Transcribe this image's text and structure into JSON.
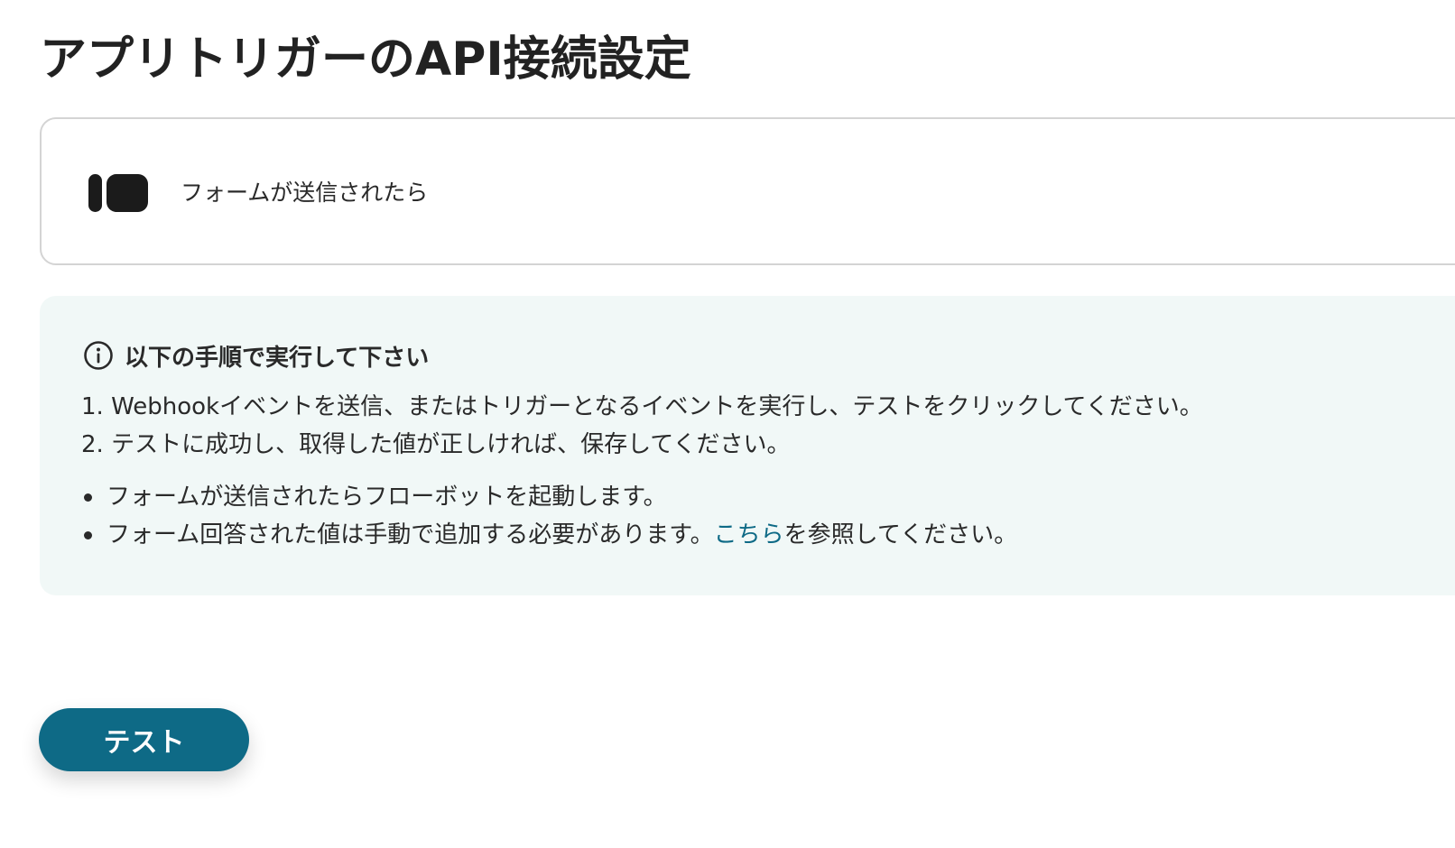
{
  "page": {
    "title": "アプリトリガーのAPI接続設定"
  },
  "trigger": {
    "icon": "app-logo-icon",
    "label": "フォームが送信されたら"
  },
  "instructions": {
    "icon": "info-icon",
    "title": "以下の手順で実行して下さい",
    "steps": [
      "1. Webhookイベントを送信、またはトリガーとなるイベントを実行し、テストをクリックしてください。",
      "2. テストに成功し、取得した値が正しければ、保存してください。"
    ],
    "notes": {
      "note1": "フォームが送信されたらフローボットを起動します。",
      "note2_before_link": "フォーム回答された値は手動で追加する必要があります。",
      "note2_link": "こちら",
      "note2_after_link": "を参照してください。"
    }
  },
  "actions": {
    "test_label": "テスト"
  },
  "colors": {
    "accent": "#0e6a86",
    "panel_background": "#f1f8f7",
    "card_border": "#d4d4d4",
    "text": "#222222"
  }
}
